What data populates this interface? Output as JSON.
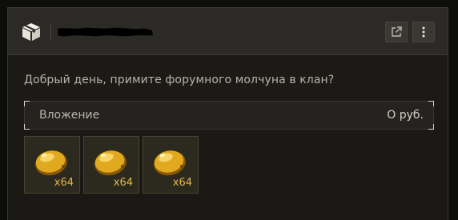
{
  "header": {
    "title_redacted": true,
    "open_icon": "external-link-icon",
    "menu_icon": "more-vertical-icon",
    "box_icon": "package-icon"
  },
  "message": {
    "text": "Добрый день, примите форумного молчуна в клан?"
  },
  "attachment": {
    "label": "Вложение",
    "value": "О руб."
  },
  "items": [
    {
      "icon": "lemon-icon",
      "quantity": "x64"
    },
    {
      "icon": "lemon-icon",
      "quantity": "x64"
    },
    {
      "icon": "lemon-icon",
      "quantity": "x64"
    }
  ],
  "colors": {
    "accent_quantity": "#e2b84b",
    "item_fruit": "#e0a91f",
    "header_bg": "#2b2a26",
    "panel_bg": "#1c1a16"
  }
}
